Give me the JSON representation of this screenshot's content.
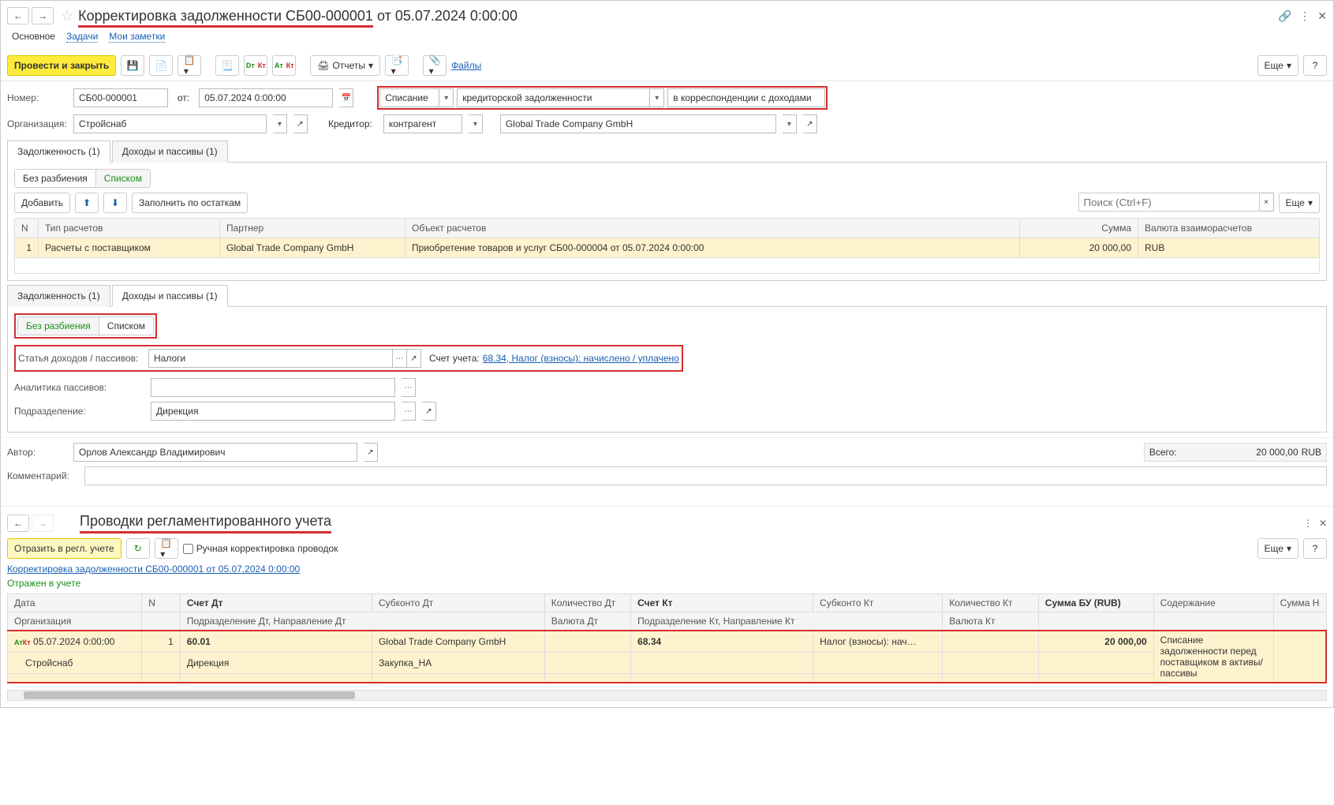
{
  "header": {
    "title_full": "Корректировка задолженности СБ00-000001 от 05.07.2024 0:00:00",
    "title_highlight": "Корректировка задолженности СБ00-000001"
  },
  "subnav": {
    "main": "Основное",
    "tasks": "Задачи",
    "notes": "Мои заметки"
  },
  "toolbar": {
    "post_close": "Провести и закрыть",
    "reports": "Отчеты",
    "files": "Файлы",
    "more": "Еще"
  },
  "fields": {
    "number_lbl": "Номер:",
    "number": "СБ00-000001",
    "from_lbl": "от:",
    "date": "05.07.2024  0:00:00",
    "op_type": "Списание",
    "debt_type": "кредиторской задолженности",
    "corr": "в корреспонденции с доходами",
    "org_lbl": "Организация:",
    "org": "Стройснаб",
    "cred_lbl": "Кредитор:",
    "cred_type": "контрагент",
    "cred_name": "Global Trade Company GmbH"
  },
  "tabs1": {
    "t1": "Задолженность (1)",
    "t2": "Доходы и пассивы (1)"
  },
  "seg": {
    "nosplit": "Без разбиения",
    "list": "Списком"
  },
  "list_tb": {
    "add": "Добавить",
    "fill": "Заполнить по остаткам",
    "search_ph": "Поиск (Ctrl+F)",
    "more": "Еще"
  },
  "grid1": {
    "h_n": "N",
    "h_type": "Тип расчетов",
    "h_partner": "Партнер",
    "h_obj": "Объект расчетов",
    "h_sum": "Сумма",
    "h_cur": "Валюта взаиморасчетов",
    "r_n": "1",
    "r_type": "Расчеты с поставщиком",
    "r_partner": "Global Trade Company GmbH",
    "r_obj": "Приобретение товаров и услуг СБ00-000004 от 05.07.2024 0:00:00",
    "r_sum": "20 000,00",
    "r_cur": "RUB"
  },
  "form2": {
    "art_lbl": "Статья доходов / пассивов:",
    "art": "Налоги",
    "acct_lbl": "Счет учета:",
    "acct_link": "68.34, Налог (взносы): начислено / уплачено",
    "ana_lbl": "Аналитика пассивов:",
    "dept_lbl": "Подразделение:",
    "dept": "Дирекция"
  },
  "footer": {
    "author_lbl": "Автор:",
    "author": "Орлов Александр Владимирович",
    "total_lbl": "Всего:",
    "total": "20 000,00",
    "cur": "RUB",
    "comment_lbl": "Комментарий:"
  },
  "section2": {
    "title": "Проводки регламентированного учета",
    "reflect": "Отразить в регл. учете",
    "manual": "Ручная корректировка проводок",
    "doc_link": "Корректировка задолженности СБ00-000001 от 05.07.2024 0:00:00",
    "reflected": "Отражен в учете",
    "more": "Еще"
  },
  "prov": {
    "h_date": "Дата",
    "h_n": "N",
    "h_dt": "Счет Дт",
    "h_subdt": "Субконто Дт",
    "h_qdt": "Количество Дт",
    "h_kt": "Счет Кт",
    "h_subkt": "Субконто Кт",
    "h_qkt": "Количество Кт",
    "h_sum": "Сумма БУ (RUB)",
    "h_content": "Содержание",
    "h_sumn": "Сумма Н",
    "h2_org": "Организация",
    "h2_pdt": "Подразделение Дт, Направление Дт",
    "h2_vdt": "Валюта Дт",
    "h2_pkt": "Подразделение Кт, Направление Кт",
    "h2_vkt": "Валюта Кт",
    "r1_date": "05.07.2024 0:00:00",
    "r1_n": "1",
    "r1_dt": "60.01",
    "r1_subdt": "Global Trade Company GmbH",
    "r1_kt": "68.34",
    "r1_subkt": "Налог (взносы): нач…",
    "r1_sum": "20 000,00",
    "r1_content": "Списание задолженности перед поставщиком в активы/пассивы",
    "r2_org": "Стройснаб",
    "r2_pdt": "Дирекция",
    "r2_subdt2": "Закупка_НА"
  }
}
